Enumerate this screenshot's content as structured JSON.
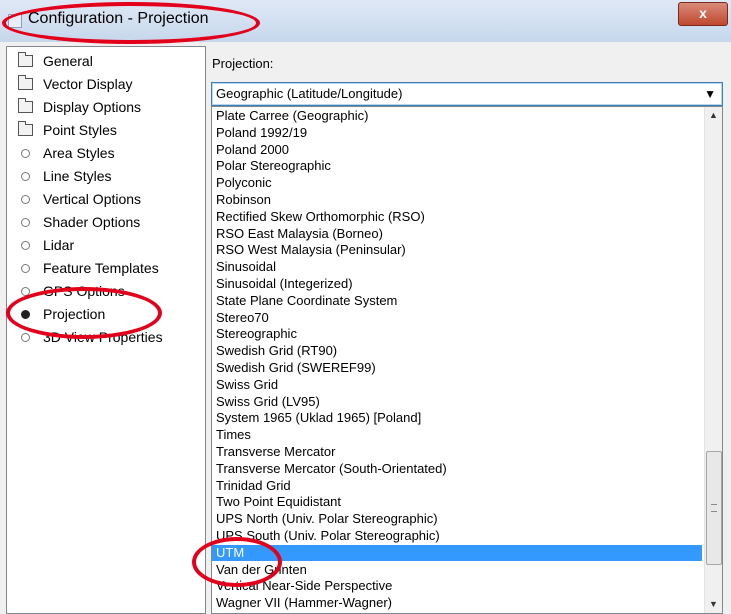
{
  "window": {
    "title": "Configuration - Projection",
    "close_label": "x"
  },
  "tree": {
    "items": [
      {
        "label": "General",
        "icon": "folder-icon"
      },
      {
        "label": "Vector Display",
        "icon": "folder-icon"
      },
      {
        "label": "Display Options",
        "icon": "folder-icon"
      },
      {
        "label": "Point Styles",
        "icon": "folder-icon"
      },
      {
        "label": "Area Styles",
        "icon": "bullet-icon"
      },
      {
        "label": "Line Styles",
        "icon": "bullet-icon"
      },
      {
        "label": "Vertical Options",
        "icon": "bullet-icon"
      },
      {
        "label": "Shader Options",
        "icon": "bullet-icon"
      },
      {
        "label": "Lidar",
        "icon": "bullet-icon"
      },
      {
        "label": "Feature Templates",
        "icon": "bullet-icon"
      },
      {
        "label": "GPS Options",
        "icon": "bullet-icon"
      },
      {
        "label": "Projection",
        "icon": "selected-bullet-icon"
      },
      {
        "label": "3D View Properties",
        "icon": "bullet-icon"
      }
    ],
    "selected": "Projection"
  },
  "projection": {
    "label": "Projection:",
    "selected_value": "Geographic (Latitude/Longitude)",
    "options": [
      "Plate Carree (Geographic)",
      "Poland 1992/19",
      "Poland 2000",
      "Polar Stereographic",
      "Polyconic",
      "Robinson",
      "Rectified Skew Orthomorphic (RSO)",
      "RSO East Malaysia (Borneo)",
      "RSO West Malaysia (Peninsular)",
      "Sinusoidal",
      "Sinusoidal (Integerized)",
      "State Plane Coordinate System",
      "Stereo70",
      "Stereographic",
      "Swedish Grid (RT90)",
      "Swedish Grid (SWEREF99)",
      "Swiss Grid",
      "Swiss Grid (LV95)",
      "System 1965 (Uklad 1965) [Poland]",
      "Times",
      "Transverse Mercator",
      "Transverse Mercator (South-Orientated)",
      "Trinidad Grid",
      "Two Point Equidistant",
      "UPS North (Univ. Polar Stereographic)",
      "UPS South (Univ. Polar Stereographic)",
      "UTM",
      "Van der Grinten",
      "Vertical Near-Side Perspective",
      "Wagner VII (Hammer-Wagner)"
    ],
    "highlighted_option": "UTM"
  },
  "colors": {
    "selection": "#3399ff",
    "annotation": "#e3001b"
  }
}
